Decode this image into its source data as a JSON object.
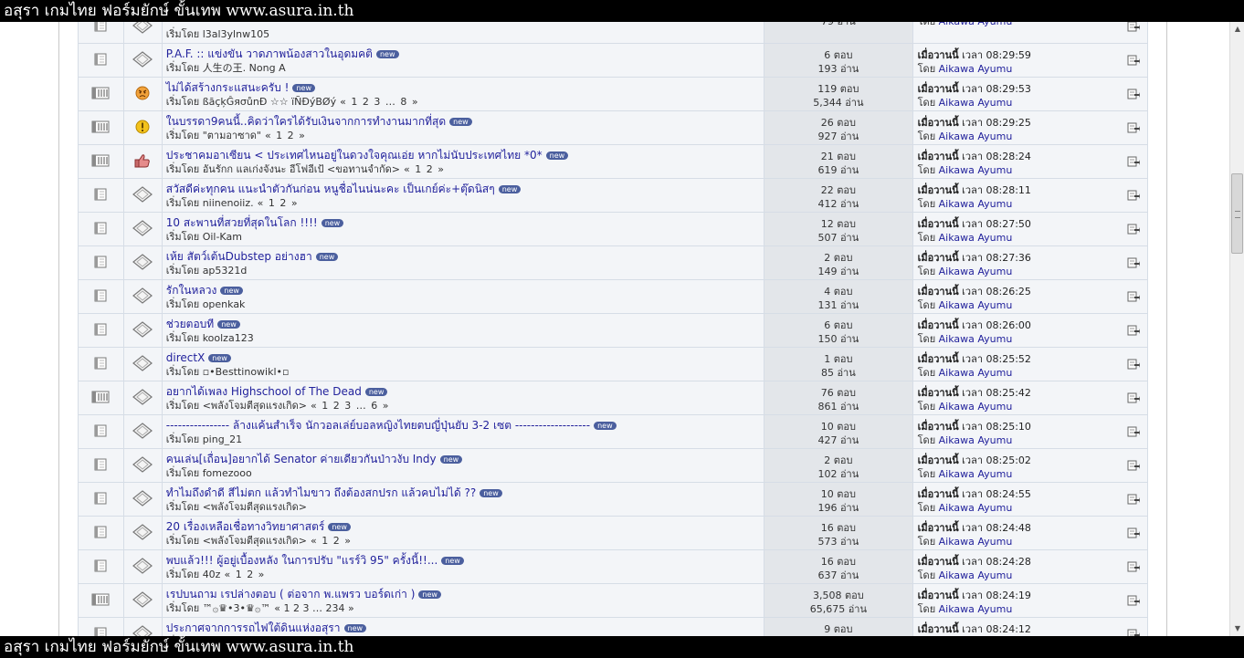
{
  "window": {
    "title": "อสุรา เกมไทย ฟอร์มยักษ์ ขั้นเทพ www.asura.in.th"
  },
  "labels": {
    "started_by": "เริ่มโดย",
    "by": "โดย",
    "today": "เมื่อวานนี้",
    "time_prefix": "เวลา",
    "new_badge": "new"
  },
  "threads": [
    {
      "title": "",
      "starter": "l3al3ylnw105",
      "pages": "",
      "replies": "",
      "views": "79 อ่าน",
      "last_time": "",
      "last_user": "Aikawa Ayumu",
      "status_icon": "doc-icon",
      "topic_icon": "diamond-icon"
    },
    {
      "title": "P.A.F. :: แข่งขัน วาดภาพน้องสาวในอุดมคติ",
      "starter": "人生の王. Nong A",
      "pages": "",
      "replies": "6 ตอบ",
      "views": "193 อ่าน",
      "last_time": "08:29:59",
      "last_user": "Aikawa Ayumu",
      "status_icon": "doc-icon",
      "topic_icon": "diamond-icon"
    },
    {
      "title": "ไม่ได้สร้างกระแสนะครับ !",
      "starter": "ßāçķĜяσůnÐ ☆☆ ïÑÐýBØý",
      "pages": "« 1 2 3 … 8 »",
      "replies": "119 ตอบ",
      "views": "5,344 อ่าน",
      "last_time": "08:29:53",
      "last_user": "Aikawa Ayumu",
      "status_icon": "hot-doc-icon",
      "topic_icon": "angry-face-icon"
    },
    {
      "title": "ในบรรดา9คนนี้..คิดว่าใครได้รับเงินจากการทำงานมากที่สุด",
      "starter": "\"ตามอาซาด\"",
      "pages": "« 1 2 »",
      "replies": "26 ตอบ",
      "views": "927 อ่าน",
      "last_time": "08:29:25",
      "last_user": "Aikawa Ayumu",
      "status_icon": "hot-doc-icon",
      "topic_icon": "exclamation-icon"
    },
    {
      "title": "ประชาคมอาเซียน < ประเทศไหนอยู่ในดวงใจคุณเอ่ย หากไม่นับประเทศไทย *0*",
      "starter": "อันรักก แลเก่งจังนะ อีโฟอีเป้ <ขอทานจำกัด>",
      "pages": "« 1 2 »",
      "replies": "21 ตอบ",
      "views": "619 อ่าน",
      "last_time": "08:28:24",
      "last_user": "Aikawa Ayumu",
      "status_icon": "hot-doc-icon",
      "topic_icon": "thumbs-up-icon"
    },
    {
      "title": "สวัสดีค่ะทุกคน แนะนำตัวกันก่อน หนูชื่อไนน่นะคะ เป็นเกย์ค่ะ+ตุ๊ดนิสๆ",
      "starter": "niinenoiiz.",
      "pages": "« 1 2 »",
      "replies": "22 ตอบ",
      "views": "412 อ่าน",
      "last_time": "08:28:11",
      "last_user": "Aikawa Ayumu",
      "status_icon": "doc-icon",
      "topic_icon": "diamond-icon"
    },
    {
      "title": "10 สะพานที่สวยที่สุดในโลก !!!!",
      "starter": "Oil-Kam",
      "pages": "",
      "replies": "12 ตอบ",
      "views": "507 อ่าน",
      "last_time": "08:27:50",
      "last_user": "Aikawa Ayumu",
      "status_icon": "doc-icon",
      "topic_icon": "diamond-icon"
    },
    {
      "title": "เห้ย สัตว์เต้นDubstep อย่างฮา",
      "starter": "ap5321d",
      "pages": "",
      "replies": "2 ตอบ",
      "views": "149 อ่าน",
      "last_time": "08:27:36",
      "last_user": "Aikawa Ayumu",
      "status_icon": "doc-icon",
      "topic_icon": "diamond-icon"
    },
    {
      "title": "รักในหลวง",
      "starter": "openkak",
      "pages": "",
      "replies": "4 ตอบ",
      "views": "131 อ่าน",
      "last_time": "08:26:25",
      "last_user": "Aikawa Ayumu",
      "status_icon": "doc-icon",
      "topic_icon": "diamond-icon"
    },
    {
      "title": "ช่วยตอบที",
      "starter": "koolza123",
      "pages": "",
      "replies": "6 ตอบ",
      "views": "150 อ่าน",
      "last_time": "08:26:00",
      "last_user": "Aikawa Ayumu",
      "status_icon": "doc-icon",
      "topic_icon": "diamond-icon"
    },
    {
      "title": "directX",
      "starter": "▫•Besttinowikl•▫",
      "pages": "",
      "replies": "1 ตอบ",
      "views": "85 อ่าน",
      "last_time": "08:25:52",
      "last_user": "Aikawa Ayumu",
      "status_icon": "doc-icon",
      "topic_icon": "diamond-icon"
    },
    {
      "title": "อยากได้เพลง Highschool of The Dead",
      "starter": "<พลังโจมตีสุดแรงเกิด>",
      "pages": "« 1 2 3 … 6 »",
      "replies": "76 ตอบ",
      "views": "861 อ่าน",
      "last_time": "08:25:42",
      "last_user": "Aikawa Ayumu",
      "status_icon": "hot-doc-icon",
      "topic_icon": "diamond-icon"
    },
    {
      "title": "---------------- ล้างแค้นสำเร็จ นักวอลเล่ย์บอลหญิงไทยตบญี่ปุ่นยับ 3-2 เซต -------------------",
      "starter": "ping_21",
      "pages": "",
      "replies": "10 ตอบ",
      "views": "427 อ่าน",
      "last_time": "08:25:10",
      "last_user": "Aikawa Ayumu",
      "status_icon": "doc-icon",
      "topic_icon": "diamond-icon"
    },
    {
      "title": "คนเล่น[เถื่อน]อยากได้ Senator ค่ายเดียวกันป่าวงับ Indy",
      "starter": "fomezooo",
      "pages": "",
      "replies": "2 ตอบ",
      "views": "102 อ่าน",
      "last_time": "08:25:02",
      "last_user": "Aikawa Ayumu",
      "status_icon": "doc-icon",
      "topic_icon": "diamond-icon"
    },
    {
      "title": "ทำไมถึงดำดี สีไม่ตก แล้วทำไมขาว ถึงต้องสกปรก แล้วคบไม่ได้ ??",
      "starter": "<พลังโจมตีสุดแรงเกิด>",
      "pages": "",
      "replies": "10 ตอบ",
      "views": "196 อ่าน",
      "last_time": "08:24:55",
      "last_user": "Aikawa Ayumu",
      "status_icon": "doc-icon",
      "topic_icon": "diamond-icon"
    },
    {
      "title": "20 เรื่องเหลือเชื่อทางวิทยาศาสตร์",
      "starter": "<พลังโจมตีสุดแรงเกิด>",
      "pages": "« 1 2 »",
      "replies": "16 ตอบ",
      "views": "573 อ่าน",
      "last_time": "08:24:48",
      "last_user": "Aikawa Ayumu",
      "status_icon": "doc-icon",
      "topic_icon": "diamond-icon"
    },
    {
      "title": "พบแล้ว!!! ผู้อยู่เบื้องหลัง ในการปรับ \"แรร์วิ 95\" ครั้งนี้!!...",
      "starter": "40z",
      "pages": "« 1 2 »",
      "replies": "16 ตอบ",
      "views": "637 อ่าน",
      "last_time": "08:24:28",
      "last_user": "Aikawa Ayumu",
      "status_icon": "doc-icon",
      "topic_icon": "diamond-icon"
    },
    {
      "title": "เรปบนถาม เรปล่างตอบ (  ต่อจาก พ.แพรว บอร์ดเก่า )",
      "starter": "™۞♛•3•♛۞™",
      "pages": "« 1 2 3 … 234 »",
      "replies": "3,508 ตอบ",
      "views": "65,675 อ่าน",
      "last_time": "08:24:19",
      "last_user": "Aikawa Ayumu",
      "status_icon": "hot-doc-icon",
      "topic_icon": "diamond-icon"
    },
    {
      "title": "ประกาศจากการรถไฟใต้ดินแห่งอสุรา",
      "starter": "",
      "pages": "",
      "replies": "9 ตอบ",
      "views": "",
      "last_time": "08:24:12",
      "last_user": "",
      "status_icon": "doc-icon",
      "topic_icon": "diamond-icon"
    }
  ]
}
